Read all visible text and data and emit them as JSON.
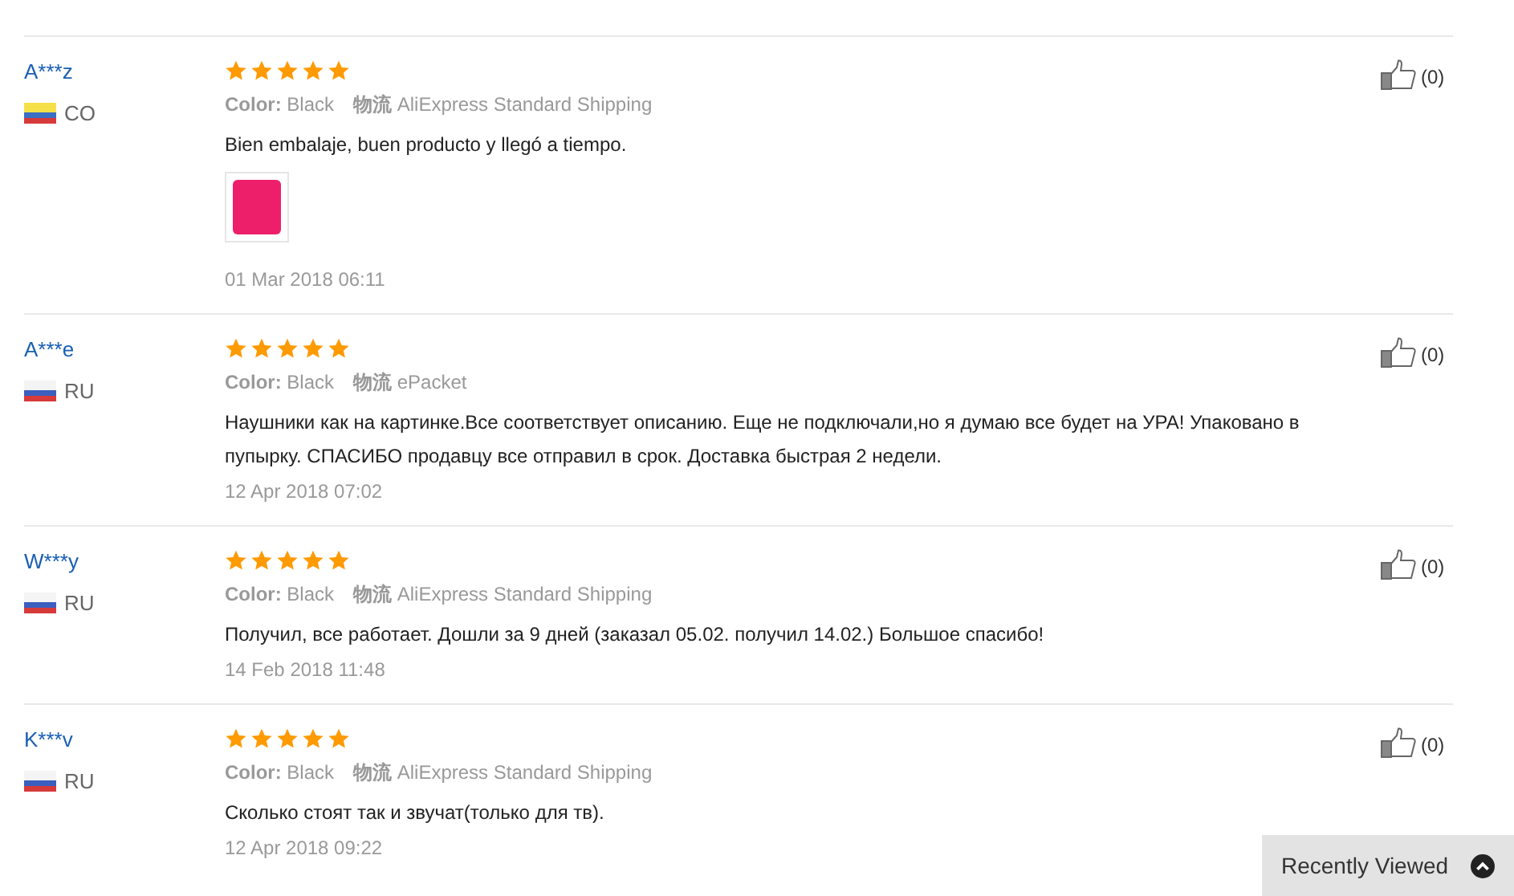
{
  "reviews": [
    {
      "user": "A***z",
      "kind": "colombia",
      "country": "CO",
      "stars": 5,
      "color_label": "Color:",
      "color_value": "Black",
      "shipping_label": "物流",
      "shipping_value": "AliExpress Standard Shipping",
      "text": "Bien embalaje, buen producto y llegó a tiempo.",
      "has_photo": true,
      "date": "01 Mar 2018 06:11",
      "likes": "(0)"
    },
    {
      "user": "A***e",
      "kind": "russia",
      "country": "RU",
      "stars": 5,
      "color_label": "Color:",
      "color_value": "Black",
      "shipping_label": "物流",
      "shipping_value": "ePacket",
      "text": "Наушники как на картинке.Все соответствует описанию. Еще не подключали,но я думаю все будет на УРА! Упаковано в пупырку. СПАСИБО продавцу все отправил в срок. Доставка быстрая 2 недели.",
      "has_photo": false,
      "date": "12 Apr 2018 07:02",
      "likes": "(0)"
    },
    {
      "user": "W***y",
      "kind": "russia",
      "country": "RU",
      "stars": 5,
      "color_label": "Color:",
      "color_value": "Black",
      "shipping_label": "物流",
      "shipping_value": "AliExpress Standard Shipping",
      "text": "Получил, все работает. Дошли за 9 дней (заказал 05.02. получил 14.02.) Большое спасибо!",
      "has_photo": false,
      "date": "14 Feb 2018 11:48",
      "likes": "(0)"
    },
    {
      "user": "K***v",
      "kind": "russia",
      "country": "RU",
      "stars": 5,
      "color_label": "Color:",
      "color_value": "Black",
      "shipping_label": "物流",
      "shipping_value": "AliExpress Standard Shipping",
      "text": "Сколько стоят так и звучат(только для тв).",
      "has_photo": false,
      "date": "12 Apr 2018 09:22",
      "likes": "(0)"
    }
  ],
  "recently_viewed": {
    "label": "Recently Viewed"
  }
}
